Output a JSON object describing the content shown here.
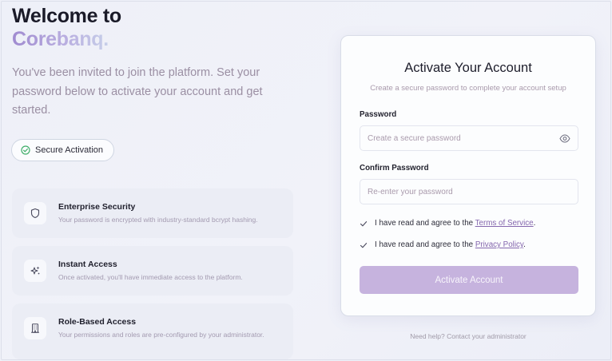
{
  "hero": {
    "title": "Welcome to",
    "brand": "Corebanq.",
    "intro": "You've been invited to join the platform. Set your password below to activate your account and get started."
  },
  "badge": {
    "label": "Secure Activation",
    "icon": "check-circle-icon"
  },
  "features": [
    {
      "title": "Enterprise Security",
      "description": "Your password is encrypted with industry-standard bcrypt hashing.",
      "icon": "shield-icon"
    },
    {
      "title": "Instant Access",
      "description": "Once activated, you'll have immediate access to the platform.",
      "icon": "sparkles-icon"
    },
    {
      "title": "Role-Based Access",
      "description": "Your permissions and roles are pre-configured by your administrator.",
      "icon": "building-icon"
    }
  ],
  "card": {
    "title": "Activate Your Account",
    "subtitle": "Create a secure password to complete your account setup",
    "password": {
      "label": "Password",
      "placeholder": "Create a secure password",
      "value": ""
    },
    "confirm": {
      "label": "Confirm Password",
      "placeholder": "Re-enter your password",
      "value": ""
    },
    "terms": {
      "prefix": "I have read and agree to the ",
      "link": "Terms of Service",
      "suffix": ".",
      "checked": true
    },
    "privacy": {
      "prefix": "I have read and agree to the ",
      "link": "Privacy Policy",
      "suffix": ".",
      "checked": true
    },
    "submit_label": "Activate Account"
  },
  "help_text": "Need help? Contact your administrator",
  "colors": {
    "accent": "#8466ad",
    "button": "#c6b3de",
    "success": "#3fae6a"
  }
}
